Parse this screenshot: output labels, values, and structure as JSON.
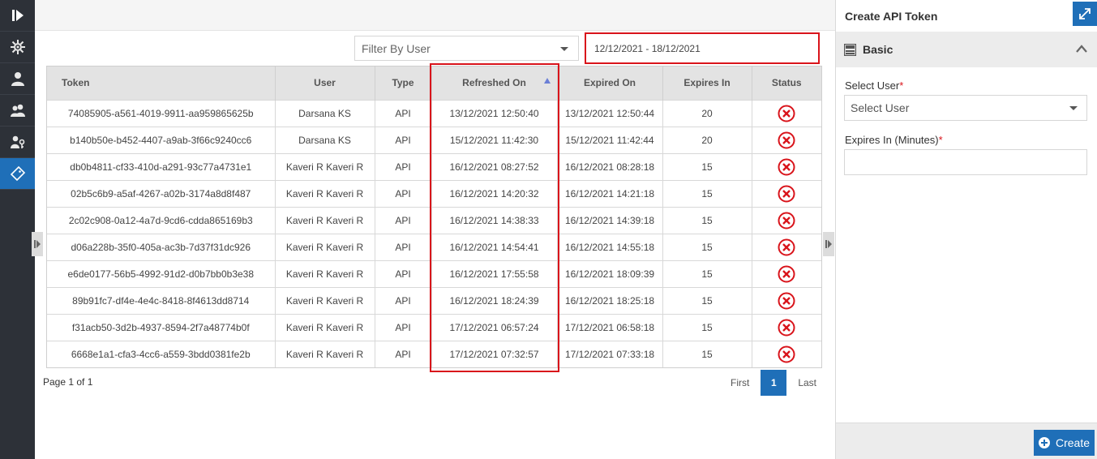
{
  "nav": {
    "items": [
      {
        "icon": "expand-toggle-icon"
      },
      {
        "icon": "gear-network-icon"
      },
      {
        "icon": "user-icon"
      },
      {
        "icon": "users-icon"
      },
      {
        "icon": "user-key-icon"
      },
      {
        "icon": "ticket-icon",
        "active": true
      }
    ]
  },
  "filters": {
    "user_placeholder": "Filter By User",
    "date_range": "12/12/2021 - 18/12/2021"
  },
  "table": {
    "columns": [
      "Token",
      "User",
      "Type",
      "Refreshed On",
      "Expired On",
      "Expires In",
      "Status"
    ],
    "sorted_column": "Refreshed On",
    "sort_direction": "ascending",
    "rows": [
      [
        "74085905-a561-4019-9911-aa959865625b",
        "Darsana KS",
        "API",
        "13/12/2021 12:50:40",
        "13/12/2021 12:50:44",
        "20",
        "expired"
      ],
      [
        "b140b50e-b452-4407-a9ab-3f66c9240cc6",
        "Darsana KS",
        "API",
        "15/12/2021 11:42:30",
        "15/12/2021 11:42:44",
        "20",
        "expired"
      ],
      [
        "db0b4811-cf33-410d-a291-93c77a4731e1",
        "Kaveri R Kaveri R",
        "API",
        "16/12/2021 08:27:52",
        "16/12/2021 08:28:18",
        "15",
        "expired"
      ],
      [
        "02b5c6b9-a5af-4267-a02b-3174a8d8f487",
        "Kaveri R Kaveri R",
        "API",
        "16/12/2021 14:20:32",
        "16/12/2021 14:21:18",
        "15",
        "expired"
      ],
      [
        "2c02c908-0a12-4a7d-9cd6-cdda865169b3",
        "Kaveri R Kaveri R",
        "API",
        "16/12/2021 14:38:33",
        "16/12/2021 14:39:18",
        "15",
        "expired"
      ],
      [
        "d06a228b-35f0-405a-ac3b-7d37f31dc926",
        "Kaveri R Kaveri R",
        "API",
        "16/12/2021 14:54:41",
        "16/12/2021 14:55:18",
        "15",
        "expired"
      ],
      [
        "e6de0177-56b5-4992-91d2-d0b7bb0b3e38",
        "Kaveri R Kaveri R",
        "API",
        "16/12/2021 17:55:58",
        "16/12/2021 18:09:39",
        "15",
        "expired"
      ],
      [
        "89b91fc7-df4e-4e4c-8418-8f4613dd8714",
        "Kaveri R Kaveri R",
        "API",
        "16/12/2021 18:24:39",
        "16/12/2021 18:25:18",
        "15",
        "expired"
      ],
      [
        "f31acb50-3d2b-4937-8594-2f7a48774b0f",
        "Kaveri R Kaveri R",
        "API",
        "17/12/2021 06:57:24",
        "17/12/2021 06:58:18",
        "15",
        "expired"
      ],
      [
        "6668e1a1-cfa3-4cc6-a559-3bdd0381fe2b",
        "Kaveri R Kaveri R",
        "API",
        "17/12/2021 07:32:57",
        "17/12/2021 07:33:18",
        "15",
        "expired"
      ]
    ]
  },
  "pager": {
    "info": "Page 1 of 1",
    "first": "First",
    "current": "1",
    "last": "Last"
  },
  "panel": {
    "title": "Create API Token",
    "section": "Basic",
    "select_user_label": "Select User",
    "select_user_value": "Select User",
    "expires_label": "Expires In (Minutes)",
    "expires_value": "",
    "required_mark": "*",
    "create_label": "Create"
  },
  "colors": {
    "accent": "#1f6fb8",
    "highlight": "#d9141b",
    "status_expired": "#d9141b"
  }
}
